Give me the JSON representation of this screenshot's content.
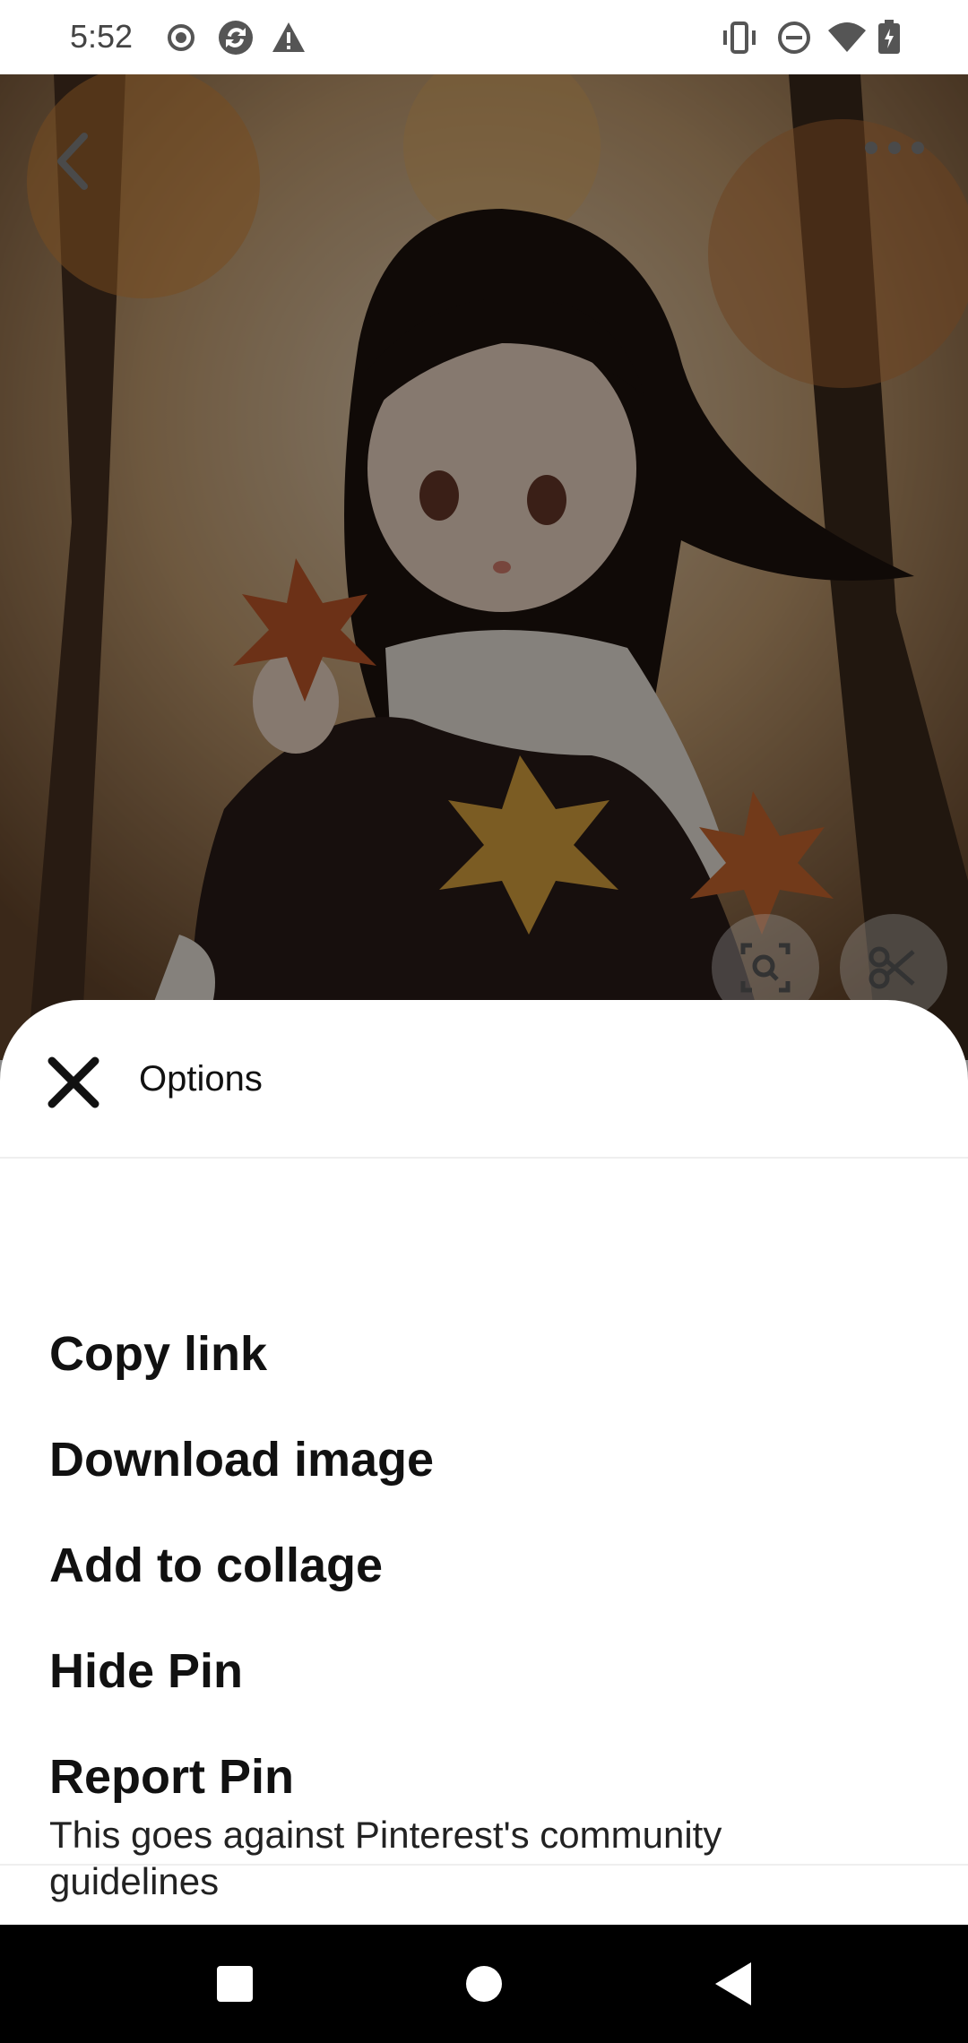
{
  "status_bar": {
    "time": "5:52",
    "left_icons": [
      "record-icon",
      "sync-icon",
      "warning-icon"
    ],
    "right_icons": [
      "vibrate-icon",
      "do-not-disturb-icon",
      "wifi-icon",
      "battery-charging-icon"
    ]
  },
  "pin": {
    "back_icon": "chevron-left-icon",
    "more_icon": "more-horizontal-icon",
    "visual_search_icon": "visual-search-icon",
    "scissors_icon": "scissors-icon"
  },
  "sheet": {
    "title": "Options",
    "close_icon": "close-icon",
    "items": [
      {
        "label": "Copy link"
      },
      {
        "label": "Download image"
      },
      {
        "label": "Add to collage"
      },
      {
        "label": "Hide Pin"
      },
      {
        "label": "Report Pin",
        "subtitle": "This goes against Pinterest's community guidelines"
      }
    ]
  },
  "nav_bar": {
    "recents_icon": "square-icon",
    "home_icon": "circle-icon",
    "back_icon": "triangle-back-icon"
  },
  "colors": {
    "sheet_bg": "#ffffff",
    "text_primary": "#111111",
    "nav_bg": "#000000",
    "scrim": "rgba(0,0,0,0.45)"
  }
}
